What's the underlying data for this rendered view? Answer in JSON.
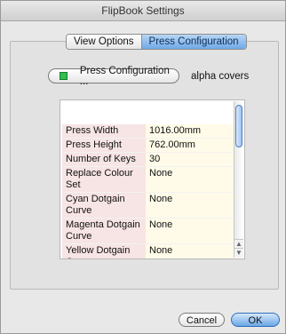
{
  "window": {
    "title": "FlipBook Settings"
  },
  "tabs": [
    {
      "label": "View Options",
      "active": false
    },
    {
      "label": "Press Configuration",
      "active": true
    }
  ],
  "press_button": {
    "label": "Press Configuration ...",
    "indicator_color": "#2fbf4b"
  },
  "alpha_label": "alpha covers",
  "table": {
    "rows": [
      {
        "key": "Press Width",
        "value": "1016.00mm"
      },
      {
        "key": "Press Height",
        "value": "762.00mm"
      },
      {
        "key": "Number of Keys",
        "value": "30"
      },
      {
        "key": "Replace Colour Set",
        "value": "None"
      },
      {
        "key": "Cyan Dotgain Curve",
        "value": "None"
      },
      {
        "key": "Magenta Dotgain Curve",
        "value": "None"
      },
      {
        "key": "Yellow Dotgain Curve",
        "value": "None"
      }
    ]
  },
  "buttons": {
    "cancel": "Cancel",
    "ok": "OK"
  }
}
